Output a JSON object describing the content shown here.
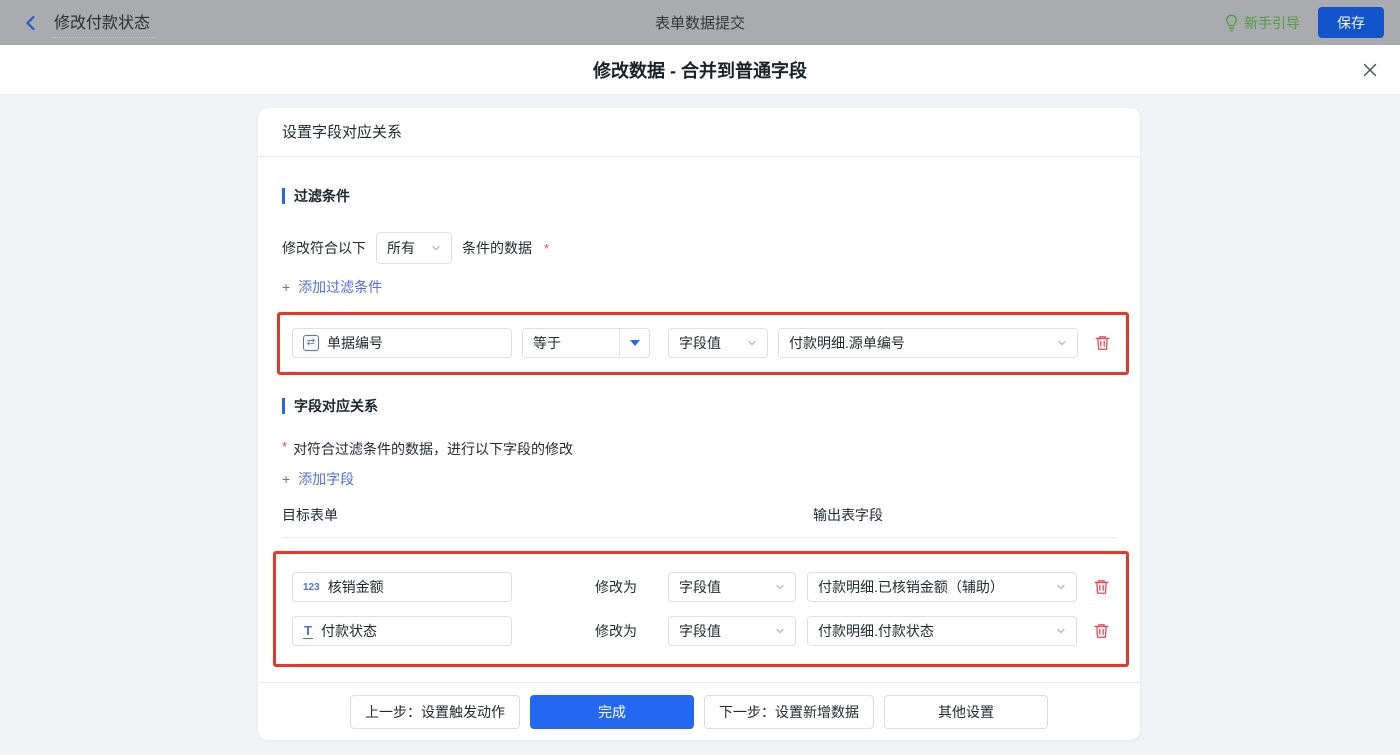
{
  "app_header": {
    "back_title": "修改付款状态",
    "center_title": "表单数据提交",
    "guide_label": "新手引导",
    "save_label": "保存"
  },
  "modal": {
    "title": "修改数据 - 合并到普通字段"
  },
  "marks": {
    "asterisk": "*",
    "plus": "+"
  },
  "field_icons": {
    "serial": "⇄",
    "number": "123",
    "text": "T"
  },
  "card": {
    "header_title": "设置字段对应关系",
    "filter": {
      "title": "过滤条件",
      "match_prefix": "修改符合以下",
      "match_value": "所有",
      "match_suffix": "条件的数据",
      "add_label": "添加过滤条件",
      "condition": {
        "field": "单据编号",
        "operator": "等于",
        "value_type": "字段值",
        "value": "付款明细.源单编号"
      }
    },
    "mapping": {
      "title": "字段对应关系",
      "hint": "对符合过滤条件的数据，进行以下字段的修改",
      "add_label": "添加字段",
      "col_target": "目标表单",
      "col_output": "输出表字段",
      "modify_label": "修改为",
      "rows": [
        {
          "field": "核销金额",
          "value_type": "字段值",
          "value": "付款明细.已核销金额（辅助）"
        },
        {
          "field": "付款状态",
          "value_type": "字段值",
          "value": "付款明细.付款状态"
        }
      ]
    },
    "footer": {
      "prev_label": "上一步：设置触发动作",
      "done_label": "完成",
      "next_label": "下一步：设置新增数据",
      "other_label": "其他设置"
    }
  },
  "colors": {
    "primary_blue": "#2468f2",
    "link_blue": "#4e6ef2",
    "annotation_red": "#e6372c",
    "trash_red": "#f0454d",
    "guide_green": "#4f9f41",
    "save_blue": "#1254cb",
    "header_dim_gray": "#a9abae"
  }
}
